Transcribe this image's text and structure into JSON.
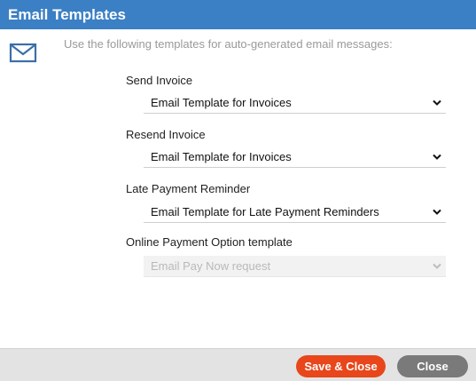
{
  "dialog": {
    "title": "Email Templates",
    "intro": "Use the following templates for auto-generated email messages:",
    "icon": "envelope-icon"
  },
  "fields": [
    {
      "label": "Send Invoice",
      "value": "Email Template for Invoices",
      "enabled": true
    },
    {
      "label": "Resend Invoice",
      "value": "Email Template for Invoices",
      "enabled": true
    },
    {
      "label": "Late Payment Reminder",
      "value": "Email Template for Late Payment Reminders",
      "enabled": true
    },
    {
      "label": "Online Payment Option template",
      "value": "Email Pay Now request",
      "enabled": false
    }
  ],
  "footer": {
    "save_label": "Save & Close",
    "close_label": "Close"
  },
  "colors": {
    "titlebar": "#3b7fc4",
    "save": "#e8461b",
    "close": "#7a7a7a",
    "icon": "#3b6fa8"
  }
}
